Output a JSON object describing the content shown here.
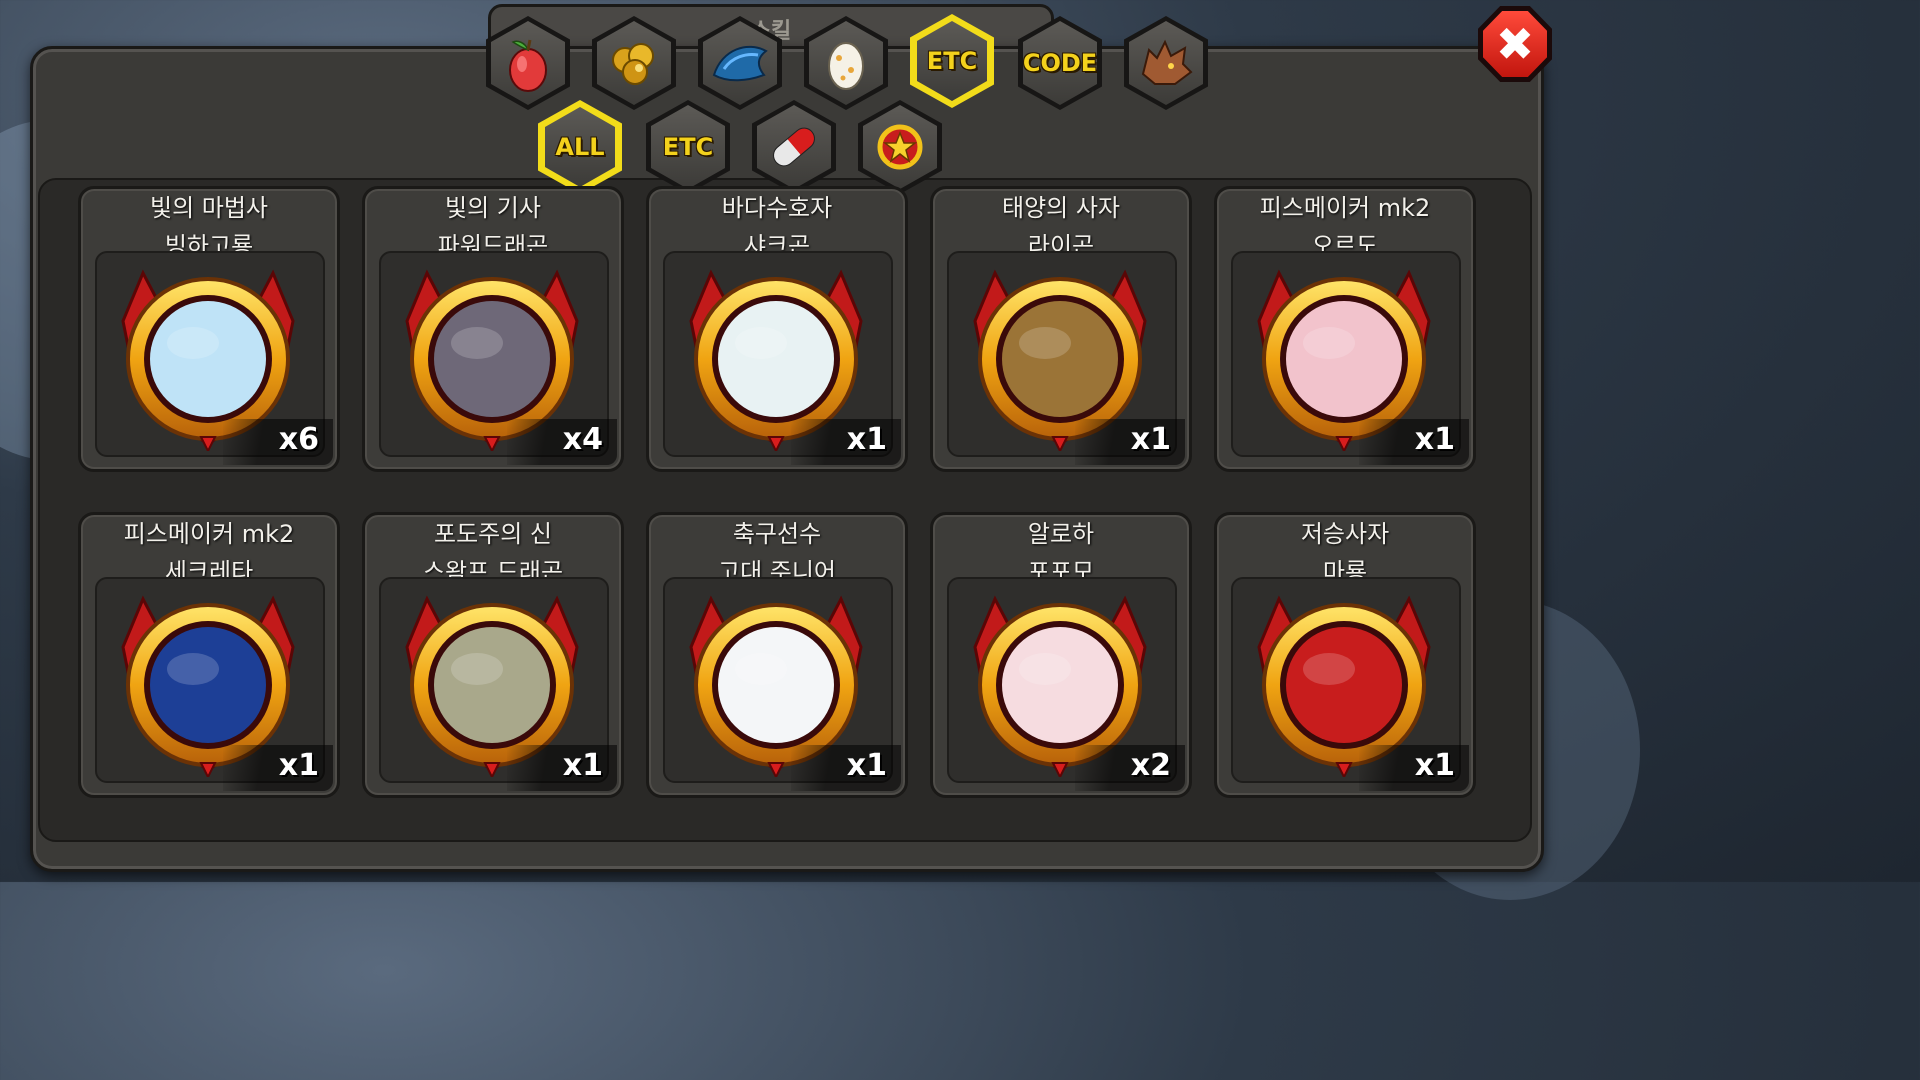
{
  "header": {
    "title": "스킬"
  },
  "tabs_row1": [
    {
      "id": "fruit",
      "icon": "fruit-icon",
      "active": false
    },
    {
      "id": "gold",
      "icon": "gold-coins-icon",
      "active": false
    },
    {
      "id": "scale",
      "icon": "dragon-scale-icon",
      "active": false
    },
    {
      "id": "egg",
      "icon": "egg-icon",
      "active": false
    },
    {
      "id": "etc",
      "label": "ETC",
      "active": true
    },
    {
      "id": "code",
      "label": "CODE",
      "active": false
    },
    {
      "id": "dragon",
      "icon": "dragon-head-icon",
      "active": false
    }
  ],
  "tabs_row2": [
    {
      "id": "all",
      "label": "ALL",
      "active": true
    },
    {
      "id": "etc2",
      "label": "ETC",
      "active": false
    },
    {
      "id": "pill",
      "icon": "capsule-icon",
      "active": false
    },
    {
      "id": "badge",
      "icon": "star-badge-icon",
      "active": false
    }
  ],
  "items": [
    {
      "line1": "빛의 마법사",
      "line2": "빙하고룡",
      "count": "x6",
      "color": "#bfe3f7"
    },
    {
      "line1": "빛의 기사",
      "line2": "파워드래곤",
      "count": "x4",
      "color": "#6e6878"
    },
    {
      "line1": "바다수호자",
      "line2": "샤크곤",
      "count": "x1",
      "color": "#e8f2f3"
    },
    {
      "line1": "태양의 사자",
      "line2": "라이곤",
      "count": "x1",
      "color": "#9b7437"
    },
    {
      "line1": "피스메이커 mk2",
      "line2": "오르도",
      "count": "x1",
      "color": "#f2c3cc"
    },
    {
      "line1": "피스메이커 mk2",
      "line2": "세크레타",
      "count": "x1",
      "color": "#1d3f96"
    },
    {
      "line1": "포도주의 신",
      "line2": "스왐프 드래곤",
      "count": "x1",
      "color": "#a9a88b"
    },
    {
      "line1": "축구선수",
      "line2": "고대 주니어",
      "count": "x1",
      "color": "#f4f6f8"
    },
    {
      "line1": "알로하",
      "line2": "포포모",
      "count": "x2",
      "color": "#f6dce0"
    },
    {
      "line1": "저승사자",
      "line2": "마룡",
      "count": "x1",
      "color": "#c81d1d"
    }
  ],
  "close": {
    "icon": "close-icon",
    "label": "✖"
  },
  "colors": {
    "accent": "#f2dc1a",
    "panel": "#3b3a37",
    "close": "#d8211a"
  }
}
